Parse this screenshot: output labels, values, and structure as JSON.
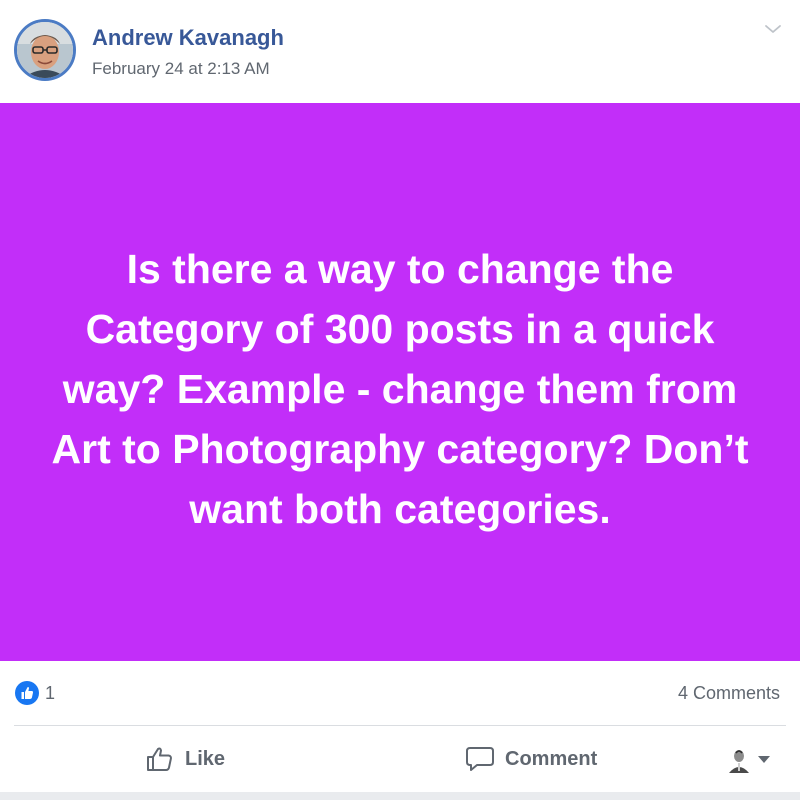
{
  "post": {
    "author_name": "Andrew Kavanagh",
    "timestamp": "February 24 at 2:13 AM",
    "text": "Is there a way to change the Category of 300 posts in a quick way? Example - change them from Art to Photography category? Don’t want both categories.",
    "background_color": "#c22ef9",
    "text_color": "#ffffff"
  },
  "icons": {
    "options": "chevron-down-icon",
    "reaction": "thumbs-up-icon",
    "like_action": "thumbs-up-outline-icon",
    "comment_action": "speech-bubble-icon",
    "audience": "caret-down-icon"
  },
  "reactions": {
    "count": "1",
    "comments_label": "4 Comments"
  },
  "actions": {
    "like_label": "Like",
    "comment_label": "Comment"
  },
  "colors": {
    "link": "#385898",
    "muted": "#606770",
    "like_blue": "#1877f2"
  }
}
